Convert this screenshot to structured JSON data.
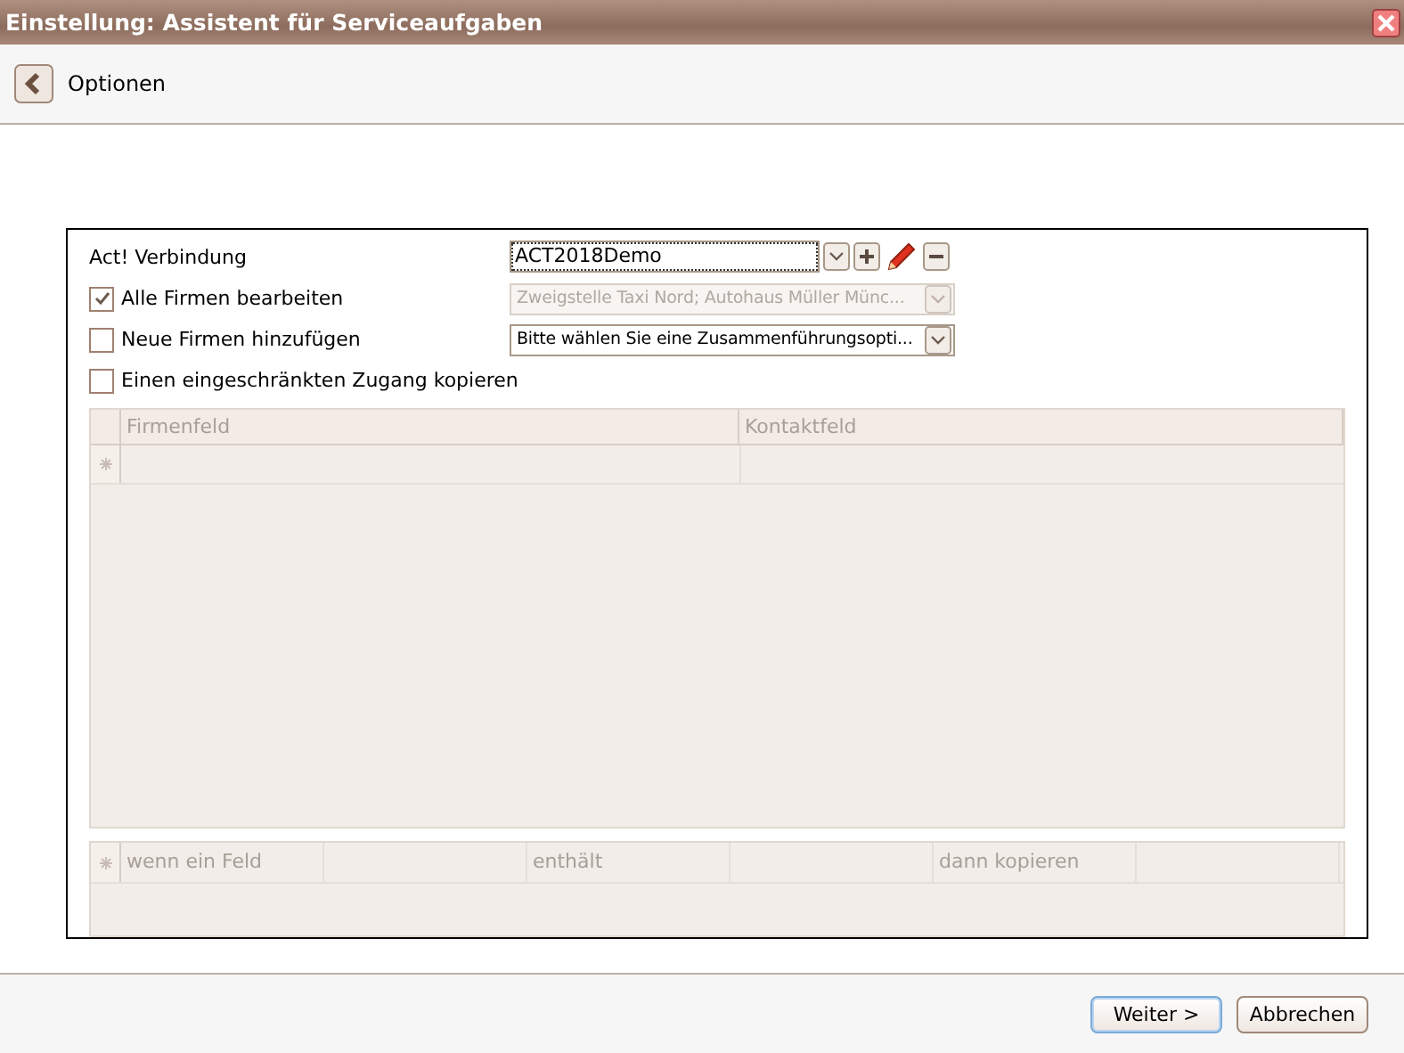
{
  "window": {
    "title": "Einstellung: Assistent für Serviceaufgaben"
  },
  "header": {
    "title": "Optionen"
  },
  "connection": {
    "label": "Act! Verbindung",
    "value": "ACT2018Demo"
  },
  "options": [
    {
      "label": "Alle Firmen bearbeiten",
      "checked": true,
      "select": {
        "value": "Zweigstelle Taxi Nord; Autohaus Müller Münc...",
        "disabled": true
      }
    },
    {
      "label": "Neue Firmen hinzufügen",
      "checked": false,
      "select": {
        "value": "Bitte wählen Sie eine Zusammenführungsopti...",
        "disabled": false
      }
    },
    {
      "label": "Einen eingeschränkten Zugang kopieren",
      "checked": false
    }
  ],
  "field_grid": {
    "columns": [
      "Firmenfeld",
      "Kontaktfeld"
    ]
  },
  "rule_grid": {
    "columns": [
      "wenn ein Feld",
      "enthält",
      "dann kopieren"
    ]
  },
  "buttons": [
    {
      "label": "Weiter >",
      "default": true
    },
    {
      "label": "Abbrechen",
      "default": false
    }
  ]
}
